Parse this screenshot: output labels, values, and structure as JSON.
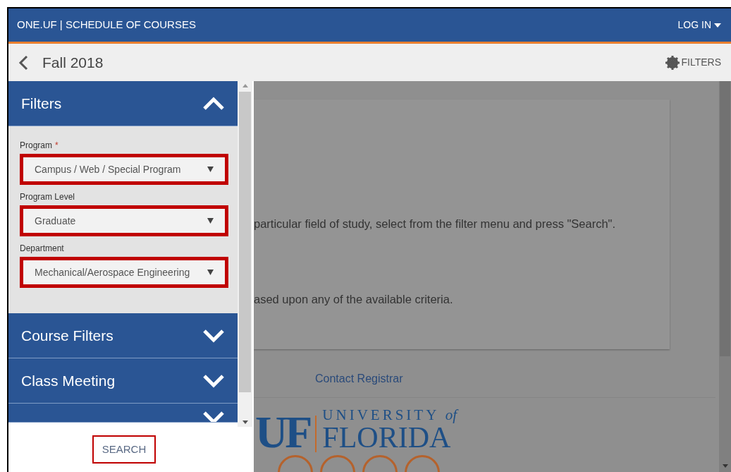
{
  "header": {
    "title": "ONE.UF | SCHEDULE OF COURSES",
    "login": "LOG IN"
  },
  "toolbar": {
    "term": "Fall 2018",
    "filters_button": "FILTERS"
  },
  "filter_panel": {
    "sections": [
      {
        "title": "Filters",
        "expanded": true
      },
      {
        "title": "Course Filters",
        "expanded": false
      },
      {
        "title": "Class Meeting",
        "expanded": false
      },
      {
        "expanded": false
      }
    ],
    "fields": [
      {
        "label": "Program",
        "required_mark": "*",
        "value": "Campus / Web / Special Program",
        "highlighted": true
      },
      {
        "label": "Program Level",
        "value": "Graduate",
        "highlighted": true
      },
      {
        "label": "Department",
        "value": "Mechanical/Aerospace Engineering",
        "highlighted": true
      }
    ],
    "search_button": {
      "label": "SEARCH",
      "highlighted": true
    }
  },
  "main": {
    "paragraphs": [
      "particular field of study, select from the filter menu and press \"Search\".",
      "ased upon any of the available criteria."
    ],
    "contact_link": "Contact Registrar",
    "logo": {
      "mark": "UF",
      "line1": "UNIVERSITY",
      "line1_suffix": "of",
      "line2": "FLORIDA"
    }
  }
}
